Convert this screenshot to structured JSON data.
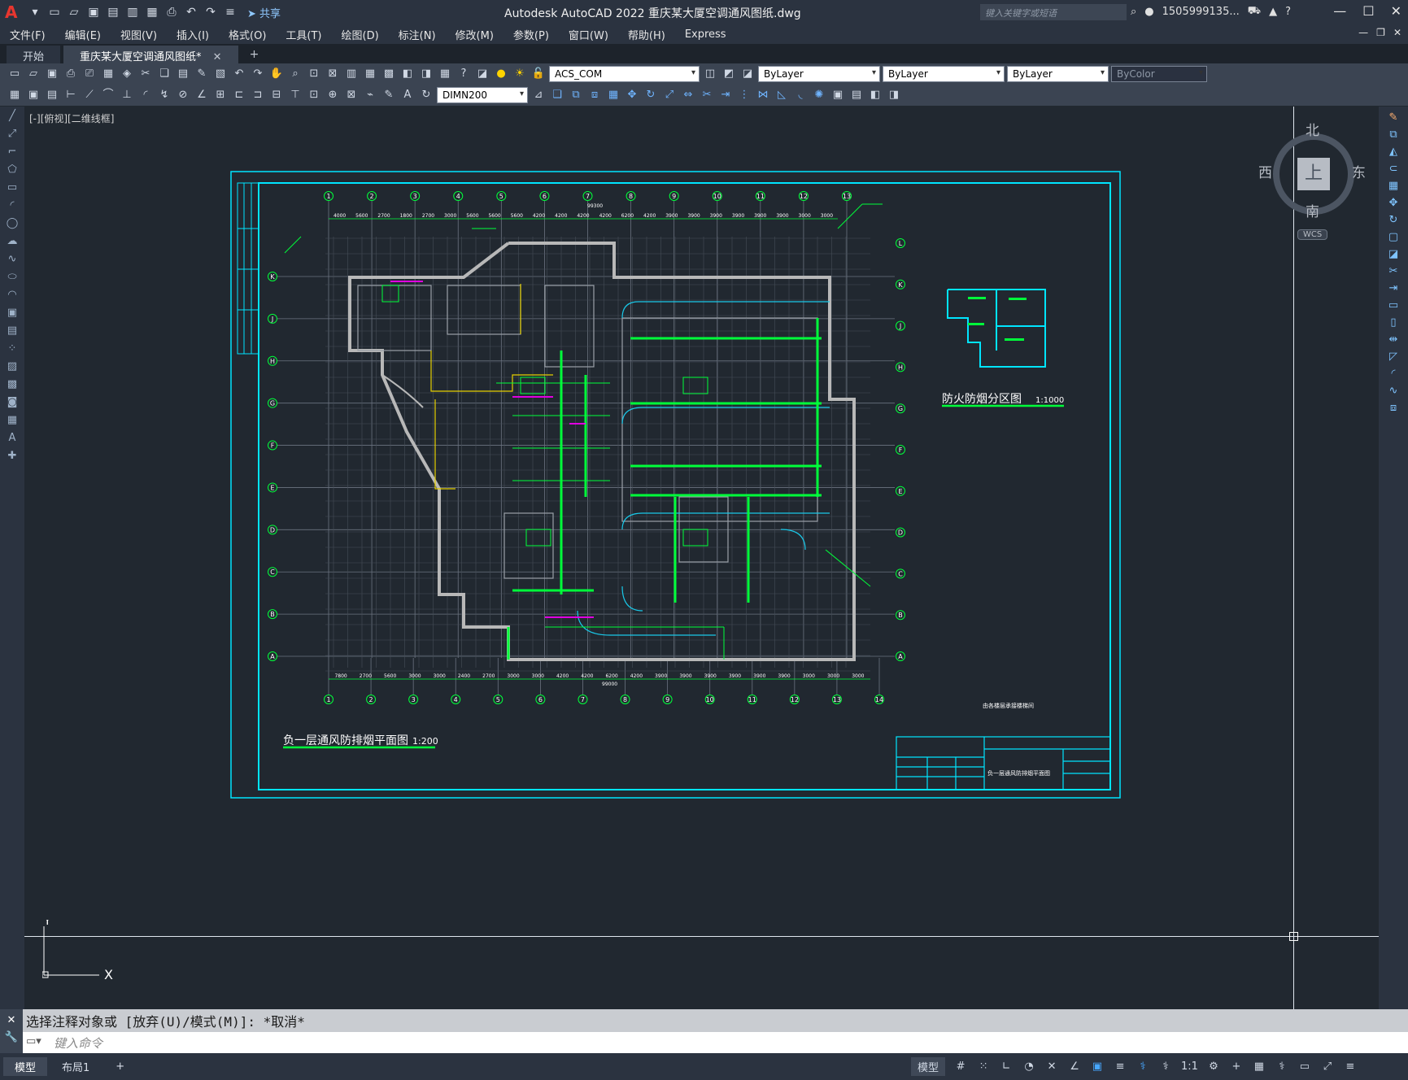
{
  "titlebar": {
    "app_logo": "A",
    "share_label": "共享",
    "title": "Autodesk AutoCAD 2022    重庆某大厦空调通风图纸.dwg",
    "search_placeholder": "键入关键字或短语",
    "user": "1505999135...",
    "help": "?"
  },
  "menubar": {
    "items": [
      "文件(F)",
      "编辑(E)",
      "视图(V)",
      "插入(I)",
      "格式(O)",
      "工具(T)",
      "绘图(D)",
      "标注(N)",
      "修改(M)",
      "参数(P)",
      "窗口(W)",
      "帮助(H)",
      "Express"
    ]
  },
  "tabs": {
    "start": "开始",
    "active_doc": "重庆某大厦空调通风图纸*",
    "close": "✕",
    "add": "+"
  },
  "toolbar": {
    "layer_combo": "ACS_COM",
    "color_combo": "ByLayer",
    "linetype_combo": "ByLayer",
    "lineweight_combo": "ByLayer",
    "plotstyle_combo": "ByColor",
    "dimstyle_combo": "DIMN200"
  },
  "viewport": {
    "label": "[-][俯视][二维线框]",
    "viewcube": {
      "north": "北",
      "south": "南",
      "east": "东",
      "west": "西",
      "face": "上",
      "wcs": "WCS"
    },
    "ucs_x": "X",
    "ucs_y": "Y"
  },
  "drawing": {
    "main_title": "负一层通风防排烟平面图",
    "main_scale": "1:200",
    "inset_title": "防火防烟分区图",
    "inset_scale": "1:1000",
    "note": "由各楼层承接楼梯间",
    "titleblock_name": "负一层通风防排烟平面图",
    "axis_top": [
      "1",
      "2",
      "3",
      "4",
      "5",
      "6",
      "7",
      "8",
      "9",
      "10",
      "11",
      "12",
      "13"
    ],
    "axis_bottom": [
      "1",
      "2",
      "3",
      "4",
      "5",
      "6",
      "7",
      "8",
      "9",
      "10",
      "11",
      "12",
      "13",
      "14"
    ],
    "axis_left": [
      "K",
      "J",
      "H",
      "G",
      "F",
      "E",
      "D",
      "C",
      "B",
      "A"
    ],
    "axis_right": [
      "L",
      "K",
      "J",
      "H",
      "G",
      "F",
      "E",
      "D",
      "C",
      "B",
      "A"
    ],
    "dims_top": [
      "4000",
      "5600",
      "2700",
      "1800",
      "2700",
      "3000",
      "5600",
      "5600",
      "5600",
      "4200",
      "4200",
      "4200",
      "4200",
      "6200",
      "4200",
      "3900",
      "3900",
      "3900",
      "3900",
      "3900",
      "3900",
      "3000",
      "3000"
    ],
    "dims_bottom": [
      "7800",
      "2700",
      "5600",
      "3000",
      "3000",
      "2400",
      "2700",
      "3000",
      "3000",
      "4200",
      "4200",
      "6200",
      "4200",
      "3900",
      "3900",
      "3900",
      "3900",
      "3900",
      "3900",
      "3000",
      "3000",
      "3000"
    ],
    "total_top": "99300",
    "total_bottom": "99000"
  },
  "command": {
    "history": "选择注释对象或 [放弃(U)/模式(M)]: *取消*",
    "input_placeholder": "键入命令"
  },
  "statusbar": {
    "layout_tabs": [
      "模型",
      "布局1"
    ],
    "add": "+",
    "model_label": "模型",
    "scale": "1:1"
  },
  "colors": {
    "cyan": "#00e5ff",
    "green": "#00ff3a",
    "grid": "#6b7380",
    "wall": "#b8b8b8",
    "yellow": "#e6d000",
    "magenta": "#e000e0"
  }
}
